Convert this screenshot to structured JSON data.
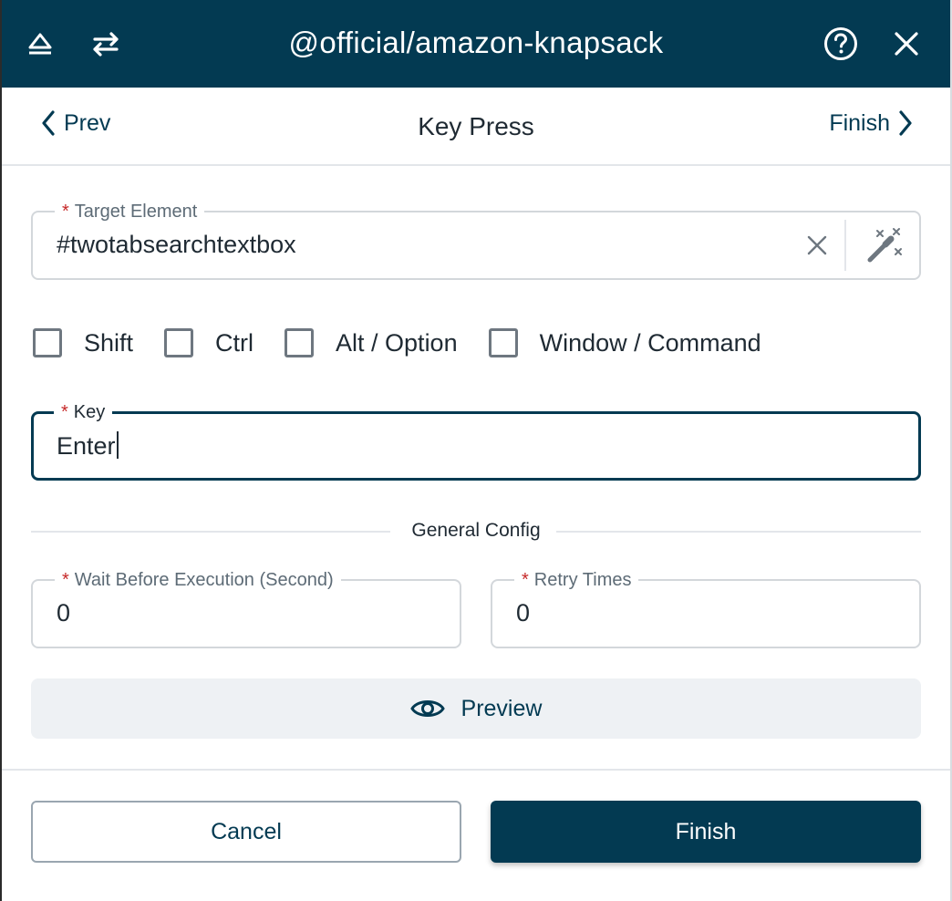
{
  "header": {
    "title": "@official/amazon-knapsack",
    "icons": {
      "collapse": "eject-icon",
      "swap": "swap-arrows-icon",
      "help": "help-circle-icon",
      "close": "close-icon"
    }
  },
  "nav": {
    "prev_label": "Prev",
    "title": "Key Press",
    "next_label": "Finish"
  },
  "target_element": {
    "required_mark": "*",
    "label": "Target Element",
    "value": "#twotabsearchtextbox"
  },
  "modifiers": [
    {
      "label": "Shift",
      "checked": false
    },
    {
      "label": "Ctrl",
      "checked": false
    },
    {
      "label": "Alt / Option",
      "checked": false
    },
    {
      "label": "Window / Command",
      "checked": false
    }
  ],
  "key_field": {
    "required_mark": "*",
    "label": "Key",
    "value": "Enter"
  },
  "general_config": {
    "section_label": "General Config",
    "wait": {
      "required_mark": "*",
      "label": "Wait Before Execution (Second)",
      "value": "0"
    },
    "retry": {
      "required_mark": "*",
      "label": "Retry Times",
      "value": "0"
    }
  },
  "preview_label": "Preview",
  "footer": {
    "cancel_label": "Cancel",
    "finish_label": "Finish"
  },
  "colors": {
    "primary": "#033a52",
    "required": "#c62828",
    "preview_bg": "#eef1f4"
  }
}
